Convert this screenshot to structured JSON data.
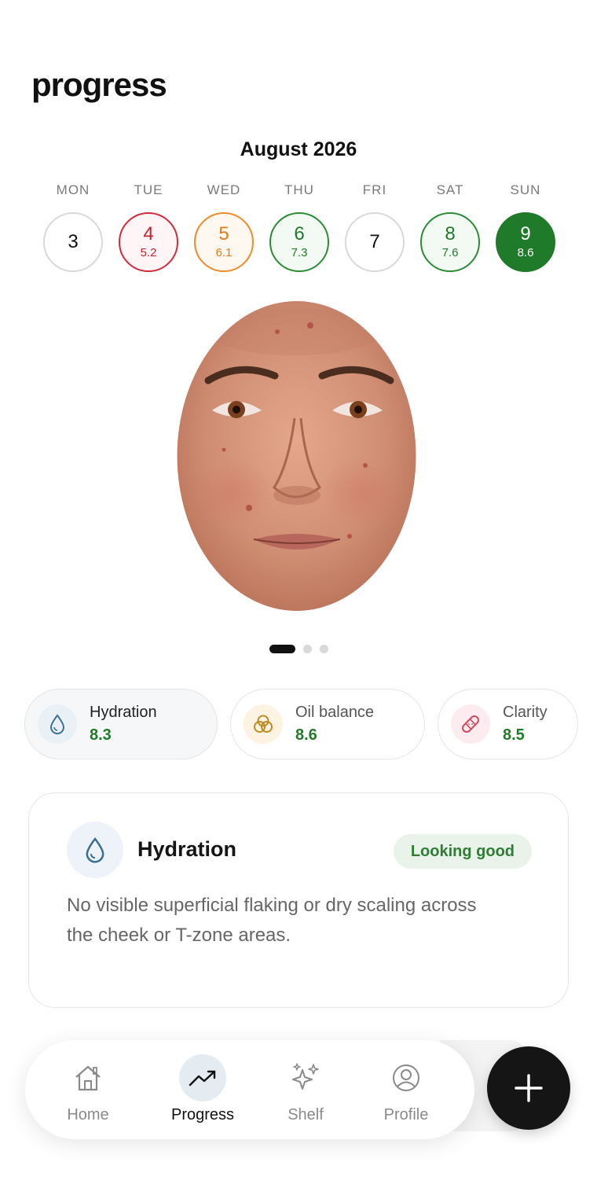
{
  "header": {
    "title": "progress"
  },
  "calendar": {
    "month": "August 2026",
    "days": [
      {
        "weekday": "MON",
        "date": "3",
        "score": "",
        "status": "none"
      },
      {
        "weekday": "TUE",
        "date": "4",
        "score": "5.2",
        "status": "poor"
      },
      {
        "weekday": "WED",
        "date": "5",
        "score": "6.1",
        "status": "fair"
      },
      {
        "weekday": "THU",
        "date": "6",
        "score": "7.3",
        "status": "good"
      },
      {
        "weekday": "FRI",
        "date": "7",
        "score": "",
        "status": "none"
      },
      {
        "weekday": "SAT",
        "date": "8",
        "score": "7.6",
        "status": "good"
      },
      {
        "weekday": "SUN",
        "date": "9",
        "score": "8.6",
        "status": "selected"
      }
    ]
  },
  "carousel": {
    "page_count": 3,
    "active_index": 0
  },
  "metrics": [
    {
      "name": "Hydration",
      "value": "8.3",
      "icon": "water-drop-icon"
    },
    {
      "name": "Oil balance",
      "value": "8.6",
      "icon": "oil-balance-icon"
    },
    {
      "name": "Clarity",
      "value": "8.5",
      "icon": "bandage-icon"
    }
  ],
  "detail": {
    "title": "Hydration",
    "badge": "Looking good",
    "description": "No visible superficial flaking or dry scaling across the cheek or T-zone areas."
  },
  "nav": {
    "tabs": [
      {
        "label": "Home",
        "icon": "home-icon"
      },
      {
        "label": "Progress",
        "icon": "trend-icon"
      },
      {
        "label": "Shelf",
        "icon": "sparkles-icon"
      },
      {
        "label": "Profile",
        "icon": "user-icon"
      }
    ],
    "active_tab": "Progress",
    "fab_icon": "plus-icon"
  },
  "colors": {
    "good": "#1f7a29",
    "fair": "#e27a14",
    "poor": "#c61f30",
    "accent_bg": "#e4ecf2"
  }
}
